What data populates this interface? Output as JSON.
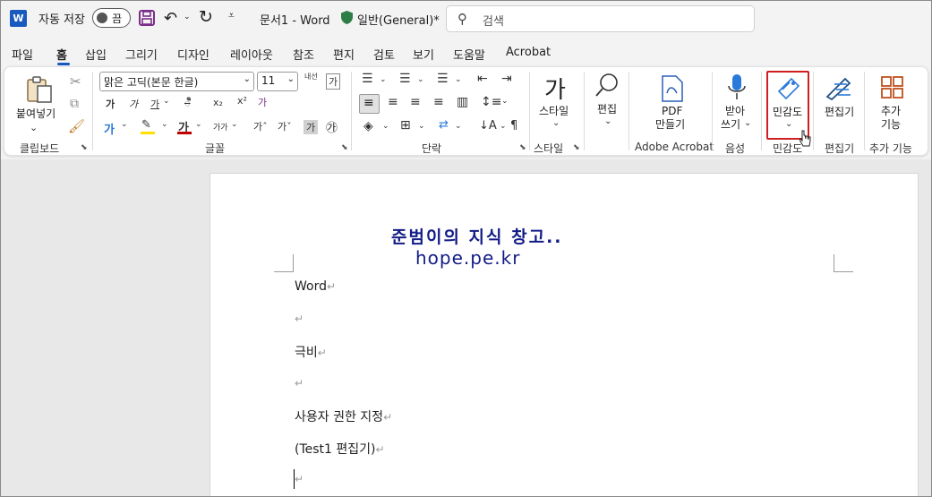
{
  "titlebar": {
    "app_logo": "W",
    "autosave_label": "자동 저장",
    "autosave_state": "끔",
    "doc_title": "문서1  -  Word",
    "sensitivity_label": "일반(General)*",
    "search_placeholder": "검색"
  },
  "tabs": [
    "파일",
    "홈",
    "삽입",
    "그리기",
    "디자인",
    "레이아웃",
    "참조",
    "편지",
    "검토",
    "보기",
    "도움말",
    "Acrobat"
  ],
  "active_tab": "홈",
  "ribbon": {
    "clipboard": {
      "paste_label": "붙여넣기",
      "group_label": "클립보드"
    },
    "font": {
      "font_name": "맑은 고딕(본문 한글)",
      "font_size": "11",
      "bold": "가",
      "italic": "가",
      "underline": "가",
      "strike": "가",
      "subscript": "x₂",
      "superscript": "x²",
      "grow": "가ˆ",
      "shrink": "가ˇ",
      "char_shade": "가",
      "enclose": "㉮",
      "phonetic": "내선",
      "font_color": "가",
      "char_spacing": "가가",
      "group_label": "글꼴"
    },
    "paragraph": {
      "group_label": "단락"
    },
    "styles": {
      "styles_label": "스타일",
      "group_label": "스타일"
    },
    "editing": {
      "edit_label": "편집"
    },
    "adobe": {
      "pdf_label_1": "PDF",
      "pdf_label_2": "만들기",
      "group_label": "Adobe Acrobat"
    },
    "voice": {
      "dictate_label_1": "받아",
      "dictate_label_2": "쓰기",
      "group_label": "음성"
    },
    "sensitivity": {
      "label": "민감도",
      "group_label": "민감도"
    },
    "editor": {
      "label": "편집기",
      "group_label": "편집기"
    },
    "addins": {
      "label_1": "추가",
      "label_2": "기능",
      "group_label": "추가 기능"
    }
  },
  "document": {
    "watermark_line1": "준범이의 지식 창고..",
    "watermark_line2": "hope.pe.kr",
    "paragraphs": [
      "Word",
      "",
      "극비",
      "",
      "사용자  권한  지정",
      "(Test1  편집기)",
      ""
    ],
    "para_mark": "↵"
  },
  "colors": {
    "accent": "#185abd",
    "highlight_box": "#d01f1f",
    "watermark": "#121c86",
    "highlighter": "#ffe000",
    "font_color_bar": "#c00000"
  }
}
